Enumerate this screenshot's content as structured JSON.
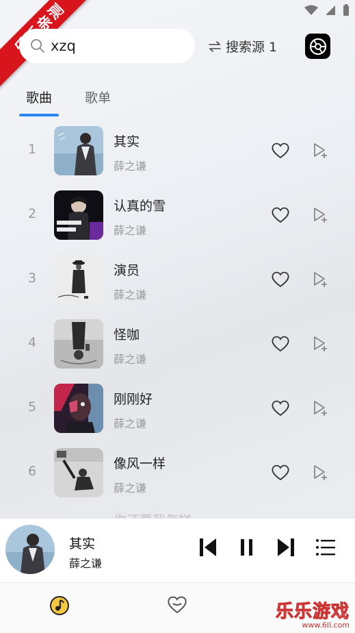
{
  "ribbon": {
    "text": "乐乐亲测"
  },
  "search": {
    "query": "xzq"
  },
  "source": {
    "label": "搜索源 1"
  },
  "tabs": [
    {
      "label": "歌曲",
      "active": true
    },
    {
      "label": "歌单",
      "active": false
    }
  ],
  "songs": [
    {
      "index": "1",
      "title": "其实",
      "artist": "薛之谦"
    },
    {
      "index": "2",
      "title": "认真的雪",
      "artist": "薛之谦"
    },
    {
      "index": "3",
      "title": "演员",
      "artist": "薛之谦"
    },
    {
      "index": "4",
      "title": "怪咖",
      "artist": "薛之谦"
    },
    {
      "index": "5",
      "title": "刚刚好",
      "artist": "薛之谦"
    },
    {
      "index": "6",
      "title": "像风一样",
      "artist": "薛之谦"
    }
  ],
  "partial_row": {
    "title": "你还要我怎样"
  },
  "player": {
    "title": "其实",
    "artist": "薛之谦"
  },
  "watermark": {
    "text": "乐乐游戏",
    "url": "www.6ll.com"
  },
  "colors": {
    "accent": "#2b86f0",
    "ribbon": "#d8141d"
  },
  "icons": [
    "search-icon",
    "swap-icon",
    "app-logo-icon",
    "heart-outline-icon",
    "add-to-playlist-icon",
    "skip-previous-icon",
    "pause-icon",
    "skip-next-icon",
    "queue-list-icon",
    "music-disc-icon",
    "heart-nav-icon"
  ]
}
